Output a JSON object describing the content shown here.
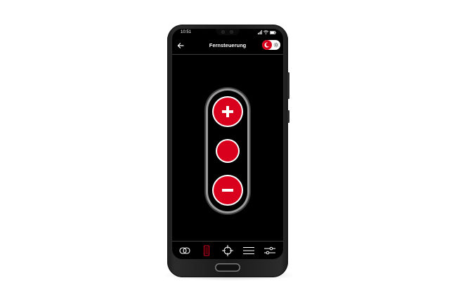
{
  "status_bar": {
    "time": "10:51"
  },
  "header": {
    "title": "Fernsteuerung",
    "back_icon": "arrow-left-icon",
    "mode_toggle_icons": [
      "moon-icon",
      "sun-icon"
    ]
  },
  "remote": {
    "buttons": [
      {
        "name": "plus",
        "icon": "plus-icon"
      },
      {
        "name": "center",
        "icon": "dot-icon"
      },
      {
        "name": "minus",
        "icon": "minus-icon"
      }
    ]
  },
  "bottom_nav": {
    "items": [
      {
        "icon": "link-icon",
        "active": false
      },
      {
        "icon": "device-icon",
        "active": true
      },
      {
        "icon": "crosshair-icon",
        "active": false
      },
      {
        "icon": "menu-icon",
        "active": false
      },
      {
        "icon": "sliders-icon",
        "active": false
      }
    ]
  },
  "colors": {
    "accent": "#d8001c",
    "background": "#000000",
    "phone_body": "#1f1f1f"
  }
}
